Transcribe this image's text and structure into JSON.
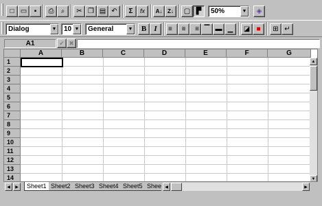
{
  "toolbar1": {
    "buttons": [
      {
        "name": "new-icon",
        "glyph": "□"
      },
      {
        "name": "open-icon",
        "glyph": "▭"
      },
      {
        "name": "save-icon",
        "glyph": "▪"
      },
      {
        "name": "print-icon",
        "glyph": "⎙"
      },
      {
        "name": "print-preview-icon",
        "glyph": "⌕"
      },
      {
        "name": "cut-icon",
        "glyph": "✂"
      },
      {
        "name": "copy-icon",
        "glyph": "❐"
      },
      {
        "name": "paste-icon",
        "glyph": "▤"
      },
      {
        "name": "undo-icon",
        "glyph": "↶"
      },
      {
        "name": "sum-icon",
        "glyph": "Σ"
      },
      {
        "name": "function-icon",
        "glyph": "fx"
      },
      {
        "name": "sort-ascending-icon",
        "glyph": "A↓"
      },
      {
        "name": "sort-descending-icon",
        "glyph": "Z↓"
      },
      {
        "name": "show-grid-icon",
        "glyph": "▢"
      },
      {
        "name": "freeze-icon",
        "glyph": "▛"
      },
      {
        "name": "properties-icon",
        "glyph": "◈"
      }
    ],
    "zoom": "50%"
  },
  "toolbar2": {
    "font": "Dialog",
    "size": "10",
    "format": "General",
    "buttons": [
      {
        "name": "bold-button",
        "glyph": "B"
      },
      {
        "name": "italic-button",
        "glyph": "I"
      },
      {
        "name": "align-left-icon",
        "glyph": "≡"
      },
      {
        "name": "align-center-icon",
        "glyph": "≡"
      },
      {
        "name": "align-right-icon",
        "glyph": "≡"
      },
      {
        "name": "border-top-icon",
        "glyph": "▔"
      },
      {
        "name": "border-middle-icon",
        "glyph": "▬"
      },
      {
        "name": "border-bottom-icon",
        "glyph": "▁"
      },
      {
        "name": "fill-color-icon",
        "glyph": "◪"
      },
      {
        "name": "font-color-icon",
        "glyph": "■"
      },
      {
        "name": "borders-icon",
        "glyph": "⊞"
      },
      {
        "name": "wrap-icon",
        "glyph": "↵"
      }
    ]
  },
  "formula_bar": {
    "cell_ref": "A1",
    "accept_glyph": "✔",
    "cancel_glyph": "✖",
    "value": ""
  },
  "columns": [
    "A",
    "B",
    "C",
    "D",
    "E",
    "F",
    "G"
  ],
  "rows": [
    "1",
    "2",
    "3",
    "4",
    "5",
    "6",
    "7",
    "8",
    "9",
    "10",
    "11",
    "12",
    "13",
    "14"
  ],
  "tabs": [
    "Sheet1",
    "Sheet2",
    "Sheet3",
    "Sheet4",
    "Sheet5",
    "Shee"
  ],
  "active_tab": "Sheet1",
  "colors": {
    "chrome": "#c0c0c0",
    "font_color_icon": "#e00000"
  }
}
